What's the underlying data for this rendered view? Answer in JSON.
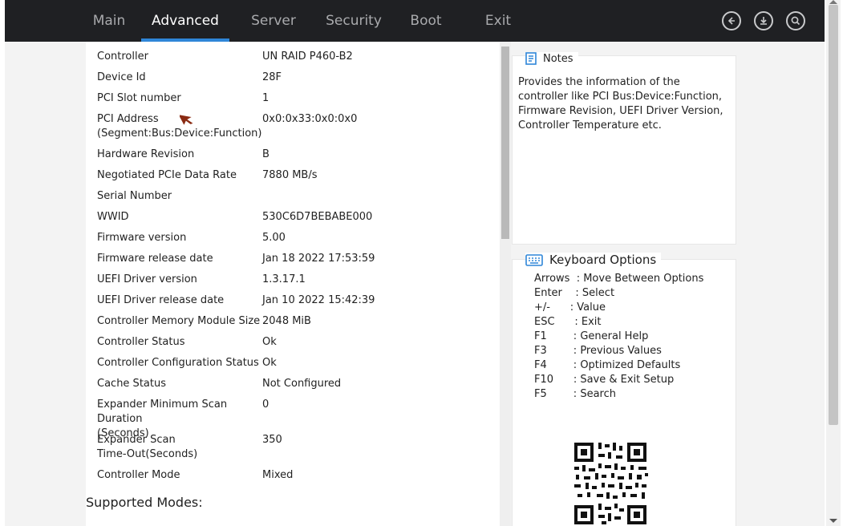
{
  "tabs": [
    {
      "label": "Main",
      "active": false
    },
    {
      "label": "Advanced",
      "active": true
    },
    {
      "label": "Server",
      "active": false
    },
    {
      "label": "Security",
      "active": false
    },
    {
      "label": "Boot",
      "active": false
    },
    {
      "label": "Exit",
      "active": false
    }
  ],
  "top_icons": [
    "back-icon",
    "save-icon",
    "search-icon"
  ],
  "rows": [
    {
      "label": "Controller",
      "value": "UN RAID P460-B2"
    },
    {
      "label": "Device Id",
      "value": "28F"
    },
    {
      "label": "PCI Slot number",
      "value": "1"
    },
    {
      "label": "PCI Address\n(Segment:Bus:Device:Function)",
      "value": "0x0:0x33:0x0:0x0"
    },
    {
      "label": "Hardware Revision",
      "value": "B"
    },
    {
      "label": "Negotiated PCIe Data Rate",
      "value": "7880 MB/s"
    },
    {
      "label": "Serial Number",
      "value": ""
    },
    {
      "label": "WWID",
      "value": "530C6D7BEBABE000"
    },
    {
      "label": "Firmware version",
      "value": "5.00"
    },
    {
      "label": "Firmware release date",
      "value": "Jan 18 2022 17:53:59"
    },
    {
      "label": "UEFI Driver version",
      "value": "1.3.17.1"
    },
    {
      "label": "UEFI Driver release date",
      "value": "Jan 10 2022 15:42:39"
    },
    {
      "label": "Controller Memory Module Size",
      "value": "2048 MiB"
    },
    {
      "label": "Controller Status",
      "value": "Ok"
    },
    {
      "label": "Controller Configuration Status",
      "value": "Ok"
    },
    {
      "label": "Cache Status",
      "value": "Not Configured"
    },
    {
      "label": "Expander Minimum Scan Duration\n(Seconds)",
      "value": "0"
    },
    {
      "label": "Expander Scan\nTime-Out(Seconds)",
      "value": "350"
    },
    {
      "label": "Controller Mode",
      "value": "Mixed"
    }
  ],
  "section_title": "Supported Modes:",
  "notes": {
    "title": "Notes",
    "text": "Provides the information of the controller like PCI Bus:Device:Function, Firmware Revision, UEFI Driver Version, Controller Temperature etc."
  },
  "keyboard": {
    "title": "Keyboard Options",
    "items": [
      "Arrows  : Move Between Options",
      "Enter    : Select",
      "+/-      : Value",
      "ESC      : Exit",
      "F1        : General Help",
      "F3        : Previous Values",
      "F4        : Optimized Defaults",
      "F10      : Save & Exit Setup",
      "F5        : Search"
    ]
  },
  "colors": {
    "topbar": "#1f2023",
    "accent": "#2f86d8",
    "tab_inactive": "#a9aaad"
  }
}
